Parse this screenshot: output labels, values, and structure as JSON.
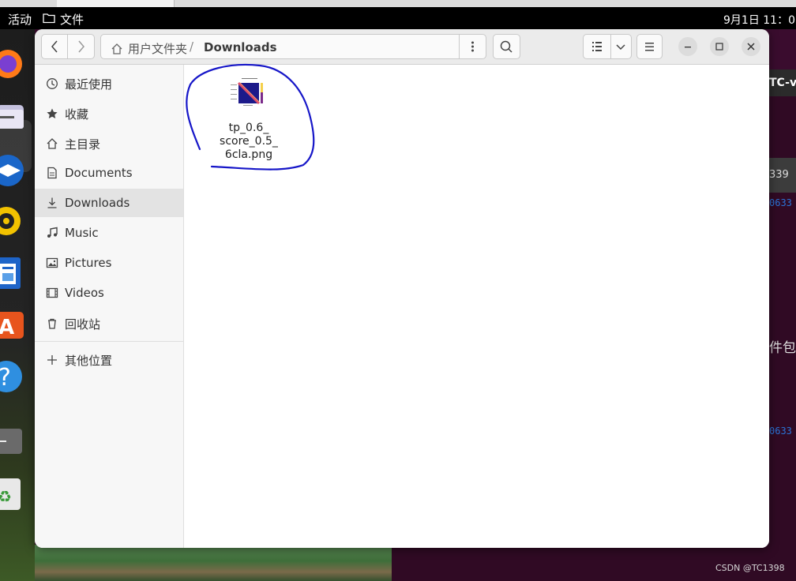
{
  "panel": {
    "activities": "活动",
    "app_menu_label": "文件",
    "clock": "9月1日 11：0"
  },
  "window": {
    "path": {
      "home": "用户文件夹",
      "separator": "/",
      "current": "Downloads"
    }
  },
  "sidebar": {
    "items": [
      {
        "label": "最近使用",
        "icon": "clock-icon"
      },
      {
        "label": "收藏",
        "icon": "star-icon"
      },
      {
        "label": "主目录",
        "icon": "home-icon"
      },
      {
        "label": "Documents",
        "icon": "document-icon"
      },
      {
        "label": "Downloads",
        "icon": "download-icon",
        "active": true
      },
      {
        "label": "Music",
        "icon": "music-icon"
      },
      {
        "label": "Pictures",
        "icon": "picture-icon"
      },
      {
        "label": "Videos",
        "icon": "video-icon"
      },
      {
        "label": "回收站",
        "icon": "trash-icon"
      }
    ],
    "other_locations": "其他位置"
  },
  "files": [
    {
      "name_lines": [
        "tp_0.6_",
        "score_0.5_",
        "6cla.png"
      ],
      "icon": "image-thumbnail",
      "annotated": true
    }
  ],
  "background": {
    "terminal_title": "TC-vp",
    "terminal_tab": "339",
    "terminal_text_1": "0633",
    "terminal_text_2": "0633",
    "terminal_cjk": "件包",
    "watermark": "CSDN @TC1398"
  },
  "colors": {
    "annotation_stroke": "#1616c8",
    "accent_active": "#e3e3e3",
    "terminal_bg": "#300a24"
  }
}
